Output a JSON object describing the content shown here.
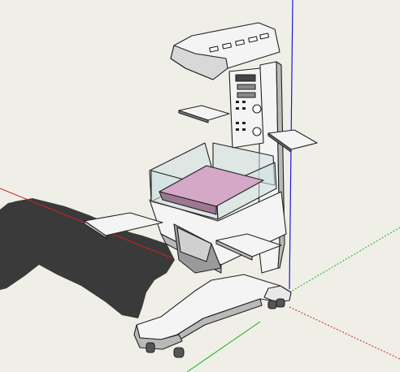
{
  "viewport": {
    "background": "#efefe7",
    "axes": {
      "red": "#d42020",
      "green": "#18b018",
      "blue": "#1818e0"
    }
  },
  "model": {
    "label": "infant-warmer-model",
    "colors": {
      "body": "#f4f4f4",
      "edge": "#222222",
      "shade": "#b9b9b9",
      "dark_shade": "#7a7a7a",
      "shadow": "#3a3a3a",
      "glass": "#cfe0e2",
      "mattress": "#d4a8c6",
      "mattress_dark": "#9b7891"
    }
  }
}
